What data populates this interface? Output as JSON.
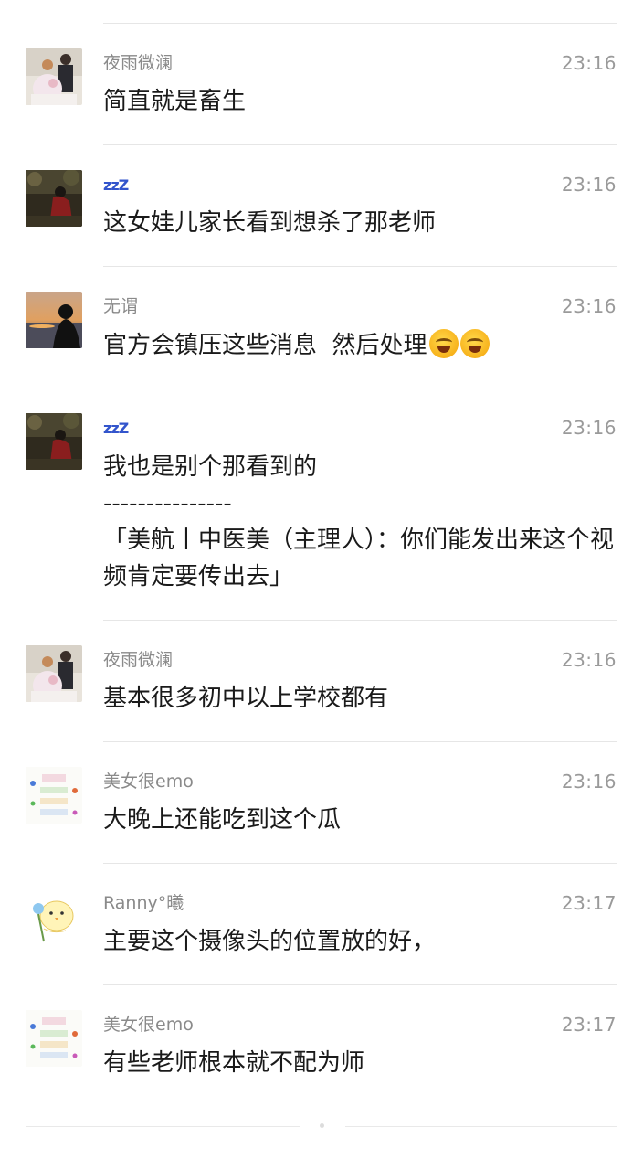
{
  "messages": [
    {
      "name": "夜雨微澜",
      "time": "23:16",
      "text": "简直就是畜生",
      "avatar": "couple-photo"
    },
    {
      "name": "zzZ",
      "time": "23:16",
      "text": "这女娃儿家长看到想杀了那老师",
      "avatar": "woman-tree-photo"
    },
    {
      "name": "无谓",
      "time": "23:16",
      "text": "官方会镇压这些消息  然后处理",
      "emoji": [
        "laugh-cry-emoji",
        "laugh-cry-emoji"
      ],
      "avatar": "sunset-silhouette-photo"
    },
    {
      "name": "zzZ",
      "time": "23:16",
      "text": "我也是别个那看到的\n---------------\n「美航丨中医美（主理人）：你们能发出来这个视频肯定要传出去」",
      "avatar": "woman-tree-photo"
    },
    {
      "name": "夜雨微澜",
      "time": "23:16",
      "text": "基本很多初中以上学校都有",
      "avatar": "couple-photo"
    },
    {
      "name": "美女很emo",
      "time": "23:16",
      "text": "大晚上还能吃到这个瓜",
      "avatar": "doodle-text-avatar"
    },
    {
      "name": "Ranny°曦",
      "time": "23:17",
      "text": "主要这个摄像头的位置放的好，",
      "avatar": "chick-cartoon-avatar"
    },
    {
      "name": "美女很emo",
      "time": "23:17",
      "text": "有些老师根本就不配为师",
      "avatar": "doodle-text-avatar"
    }
  ]
}
